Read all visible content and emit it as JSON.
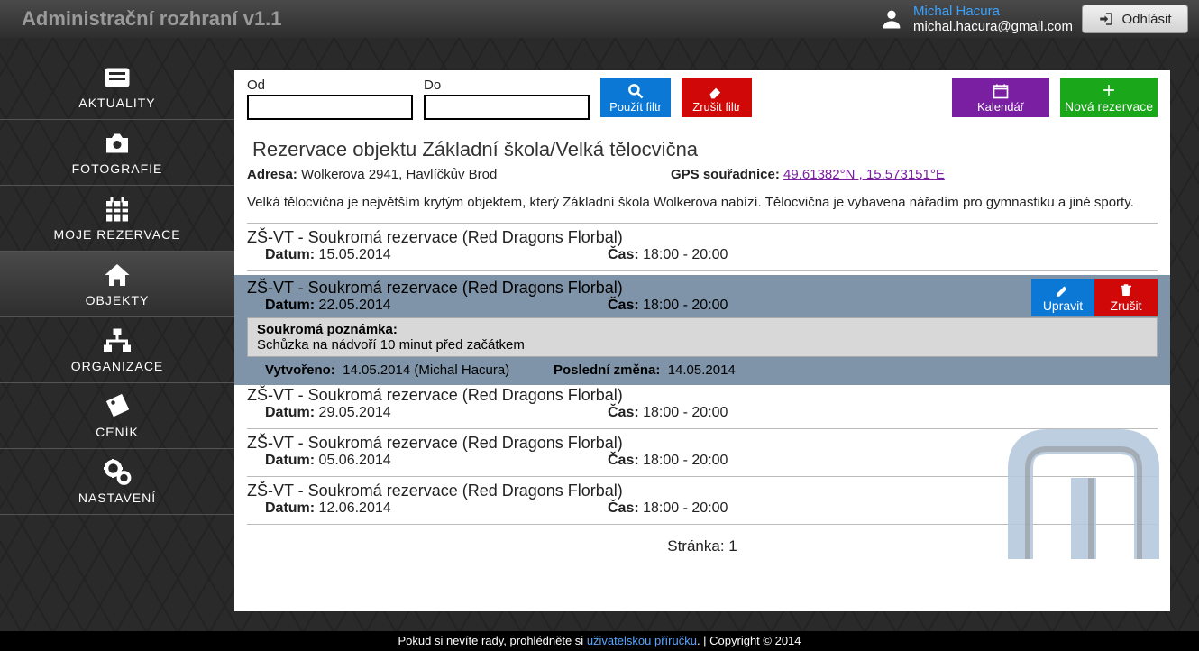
{
  "app_title": "Administrační rozhraní v1.1",
  "user": {
    "name": "Michal Hacura",
    "email": "michal.hacura@gmail.com"
  },
  "logout_label": "Odhlásit",
  "nav": [
    {
      "id": "aktuality",
      "label": "AKTUALITY"
    },
    {
      "id": "fotografie",
      "label": "FOTOGRAFIE"
    },
    {
      "id": "rezervace",
      "label": "MOJE REZERVACE"
    },
    {
      "id": "objekty",
      "label": "OBJEKTY",
      "active": true
    },
    {
      "id": "organizace",
      "label": "ORGANIZACE"
    },
    {
      "id": "cenik",
      "label": "CENÍK"
    },
    {
      "id": "nastaveni",
      "label": "NASTAVENÍ"
    }
  ],
  "filter": {
    "from_label": "Od",
    "to_label": "Do",
    "from_value": "",
    "to_value": "",
    "apply": "Použít filtr",
    "reset": "Zrušit filtr"
  },
  "actions": {
    "calendar": "Kalendář",
    "new": "Nová rezervace"
  },
  "object": {
    "title": "Rezervace objektu Základní škola/Velká tělocvična",
    "address_label": "Adresa:",
    "address": "Wolkerova 2941, Havlíčkův Brod",
    "gps_label": "GPS souřadnice:",
    "gps": "49.61382°N , 15.573151°E",
    "description": "Velká tělocvična je největším krytým objektem, který Základní škola Wolkerova nabízí. Tělocvična je vybavena nářadím pro gymnastiku a jiné sporty."
  },
  "labels": {
    "date": "Datum:",
    "time": "Čas:",
    "note": "Soukromá poznámka:",
    "created": "Vytvořeno:",
    "changed": "Poslední změna:",
    "edit": "Upravit",
    "delete": "Zrušit"
  },
  "reservations": [
    {
      "title": "ZŠ-VT - Soukromá rezervace (Red Dragons Florbal)",
      "date": "15.05.2014",
      "time": "18:00 - 20:00"
    },
    {
      "title": "ZŠ-VT - Soukromá rezervace (Red Dragons Florbal)",
      "date": "22.05.2014",
      "time": "18:00 - 20:00",
      "selected": true,
      "note": "Schůzka na nádvoří 10 minut před začátkem",
      "created": "14.05.2014 (Michal Hacura)",
      "changed": "14.05.2014"
    },
    {
      "title": "ZŠ-VT - Soukromá rezervace (Red Dragons Florbal)",
      "date": "29.05.2014",
      "time": "18:00 - 20:00"
    },
    {
      "title": "ZŠ-VT - Soukromá rezervace (Red Dragons Florbal)",
      "date": "05.06.2014",
      "time": "18:00 - 20:00"
    },
    {
      "title": "ZŠ-VT - Soukromá rezervace (Red Dragons Florbal)",
      "date": "12.06.2014",
      "time": "18:00 - 20:00"
    }
  ],
  "pager": {
    "label": "Stránka:",
    "page": "1"
  },
  "footer": {
    "prefix": "Pokud si nevíte rady, prohlédněte si ",
    "link": "uživatelskou příručku",
    "suffix": ". | Copyright © 2014"
  }
}
